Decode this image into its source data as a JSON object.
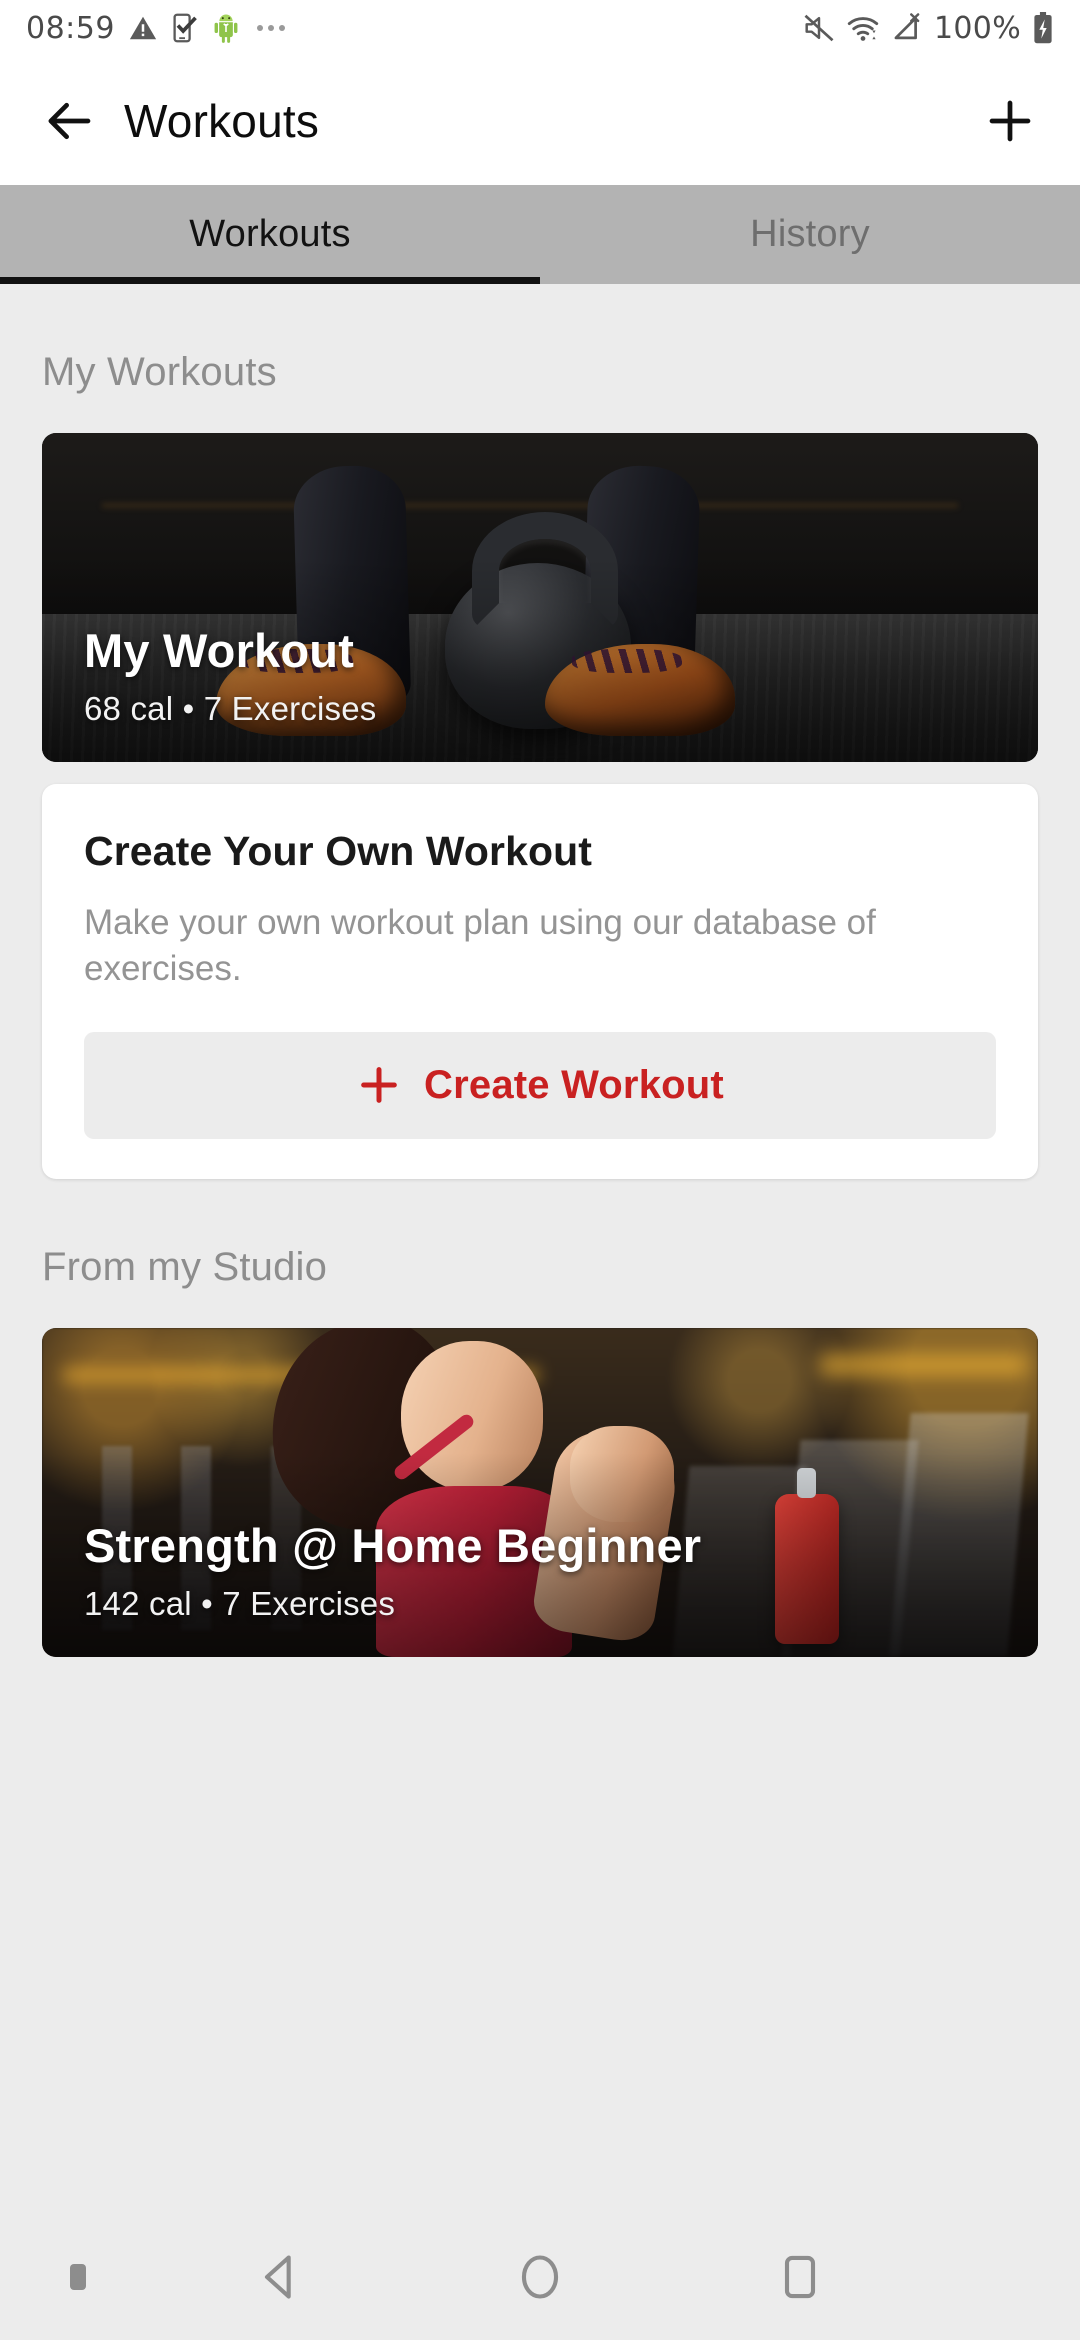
{
  "status_bar": {
    "time": "08:59",
    "battery_percent": "100%",
    "left_icons": [
      "warning-triangle-icon",
      "phone-check-icon",
      "android-robot-icon",
      "more-dots-icon"
    ],
    "right_icons": [
      "volume-muted-icon",
      "wifi-icon",
      "cellular-no-sim-icon",
      "battery-charging-icon"
    ]
  },
  "app_bar": {
    "title": "Workouts",
    "back_icon": "arrow-left-icon",
    "add_icon": "plus-icon"
  },
  "tabs": [
    {
      "label": "Workouts",
      "active": true
    },
    {
      "label": "History",
      "active": false
    }
  ],
  "sections": [
    {
      "title": "My Workouts",
      "workout_card": {
        "title": "My Workout",
        "subtitle": "68 cal • 7 Exercises",
        "calories": "68 cal",
        "exercises": "7 Exercises",
        "image": "kettlebell-feet-photo"
      },
      "create_card": {
        "title": "Create Your Own Workout",
        "body": "Make your own workout plan using our database of exercises.",
        "button_label": "Create Workout",
        "button_icon": "plus-icon"
      }
    },
    {
      "title": "From my Studio",
      "workout_card": {
        "title": "Strength @ Home Beginner",
        "subtitle": "142 cal • 7 Exercises",
        "calories": "142 cal",
        "exercises": "7 Exercises",
        "image": "woman-gym-red-top-photo"
      }
    }
  ],
  "nav_bar": {
    "back_icon": "nav-back-triangle-icon",
    "home_icon": "nav-home-circle-icon",
    "recents_icon": "nav-recents-square-icon",
    "indicator_icon": "nav-keyboard-indicator-icon"
  },
  "colors": {
    "accent_red": "#c92121",
    "page_bg": "#ececec",
    "tab_bar_bg": "#b3b3b3",
    "section_title": "#8d8d8d"
  }
}
